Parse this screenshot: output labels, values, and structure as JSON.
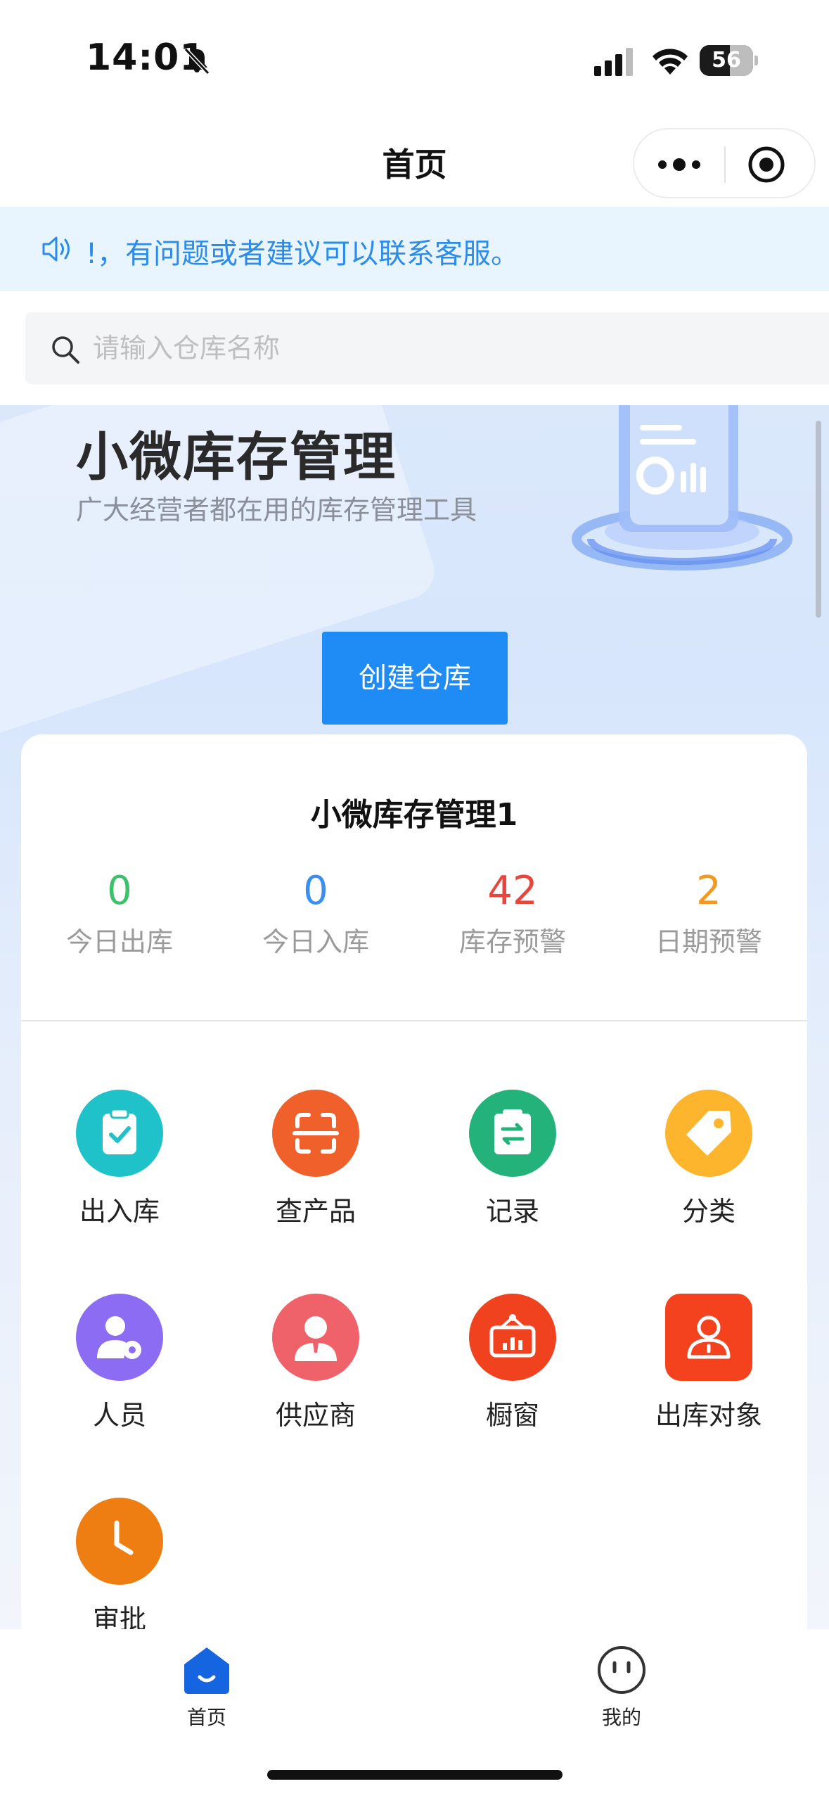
{
  "status_bar": {
    "time": "14:01",
    "battery": "56"
  },
  "navbar": {
    "title": "首页"
  },
  "notice": {
    "text": "!，有问题或者建议可以联系客服。"
  },
  "search": {
    "placeholder": "请输入仓库名称"
  },
  "hero": {
    "title": "小微库存管理",
    "subtitle": "广大经营者都在用的库存管理工具",
    "create_button": "创建仓库"
  },
  "warehouse": {
    "name": "小微库存管理1",
    "stats": [
      {
        "value": "0",
        "label": "今日出库",
        "color": "#3cc26a"
      },
      {
        "value": "0",
        "label": "今日入库",
        "color": "#3a8ff0"
      },
      {
        "value": "42",
        "label": "库存预警",
        "color": "#e8453c"
      },
      {
        "value": "2",
        "label": "日期预警",
        "color": "#f29a1f"
      }
    ]
  },
  "menu": [
    {
      "label": "出入库",
      "icon": "clipboard-check-icon",
      "color": "#1ec2c8"
    },
    {
      "label": "查产品",
      "icon": "scan-icon",
      "color": "#f0602a"
    },
    {
      "label": "记录",
      "icon": "record-icon",
      "color": "#22b27a"
    },
    {
      "label": "分类",
      "icon": "tag-icon",
      "color": "#fcb52c"
    },
    {
      "label": "人员",
      "icon": "user-gear-icon",
      "color": "#8b6cf3"
    },
    {
      "label": "供应商",
      "icon": "supplier-icon",
      "color": "#f0626a"
    },
    {
      "label": "橱窗",
      "icon": "showcase-icon",
      "color": "#f1421f"
    },
    {
      "label": "出库对象",
      "icon": "person-icon",
      "color": "#f4421e"
    },
    {
      "label": "审批",
      "icon": "clock-icon",
      "color": "#ee7d12"
    }
  ],
  "tabbar": {
    "tabs": [
      {
        "label": "首页",
        "icon": "home-icon",
        "active": true
      },
      {
        "label": "我的",
        "icon": "profile-face-icon",
        "active": false
      }
    ]
  },
  "colors": {
    "accent": "#1f8cf5",
    "notice_text": "#2b8ceb",
    "notice_bg": "#e9f5fe"
  }
}
